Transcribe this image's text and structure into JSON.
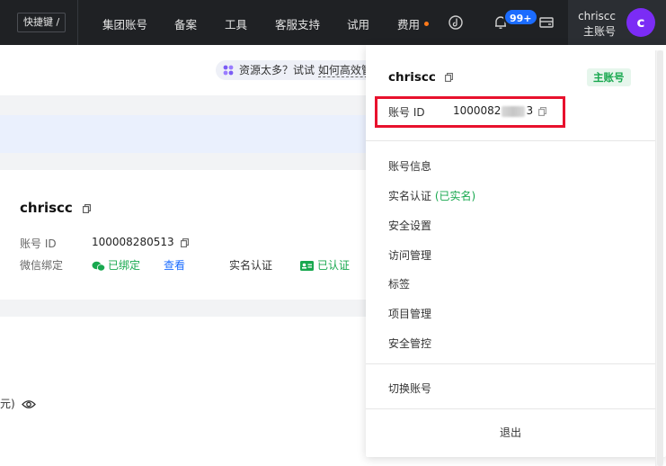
{
  "topbar": {
    "shortcut_label": "快捷键 /",
    "nav": [
      "集团账号",
      "备案",
      "工具",
      "客服支持",
      "试用",
      "费用"
    ],
    "notification_badge": "99+",
    "account_name": "chriscc",
    "account_role": "主账号",
    "avatar_letter": "c",
    "fee_dot_color": "#ff7a1a"
  },
  "hint": {
    "prefix": "资源太多？试试",
    "link": "如何高效管"
  },
  "profile": {
    "name": "chriscc",
    "id_label": "账号 ID",
    "id_value": "100008280513",
    "wechat_label": "微信绑定",
    "wechat_status": "已绑定",
    "wechat_action": "查看",
    "realname_label": "实名认证",
    "realname_status": "已认证",
    "bottom_text": "元)"
  },
  "dropdown": {
    "name": "chriscc",
    "tag": "主账号",
    "id_label": "账号 ID",
    "id_prefix": "1000082",
    "id_suffix": "3",
    "menu": [
      "账号信息",
      "实名认证",
      "安全设置",
      "访问管理",
      "标签",
      "项目管理",
      "安全管控"
    ],
    "realname_status": "(已实名)",
    "switch_label": "切换账号",
    "logout_label": "退出"
  },
  "colors": {
    "topbar_bg": "#1f2124",
    "accent_blue": "#1b6cff",
    "success_green": "#18a84f",
    "highlight_red": "#e8112d",
    "avatar_purple": "#7b2cf5"
  }
}
